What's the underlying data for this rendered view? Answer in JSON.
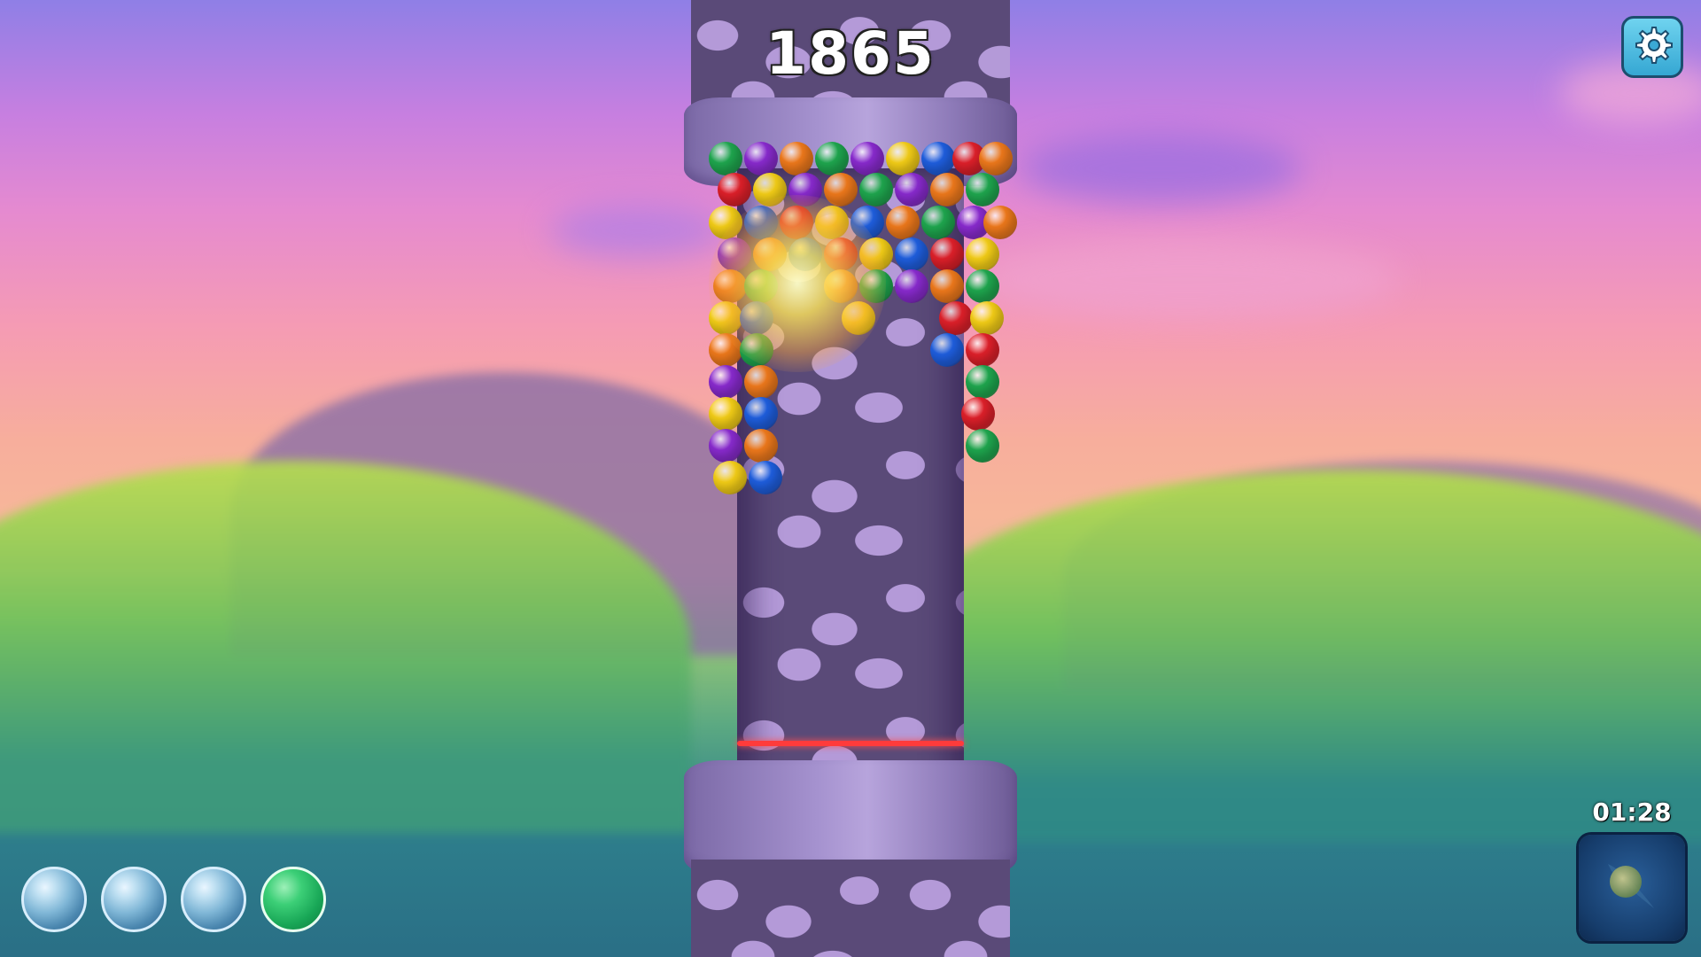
{
  "hud": {
    "score": "1865",
    "timer": "01:28",
    "settings_icon": "gear-icon",
    "powerup_icon": "comet-powerup-icon"
  },
  "ball_queue": [
    {
      "state": "empty",
      "icon": "empty-bubble-icon"
    },
    {
      "state": "empty",
      "icon": "empty-bubble-icon"
    },
    {
      "state": "empty",
      "icon": "empty-bubble-icon"
    },
    {
      "state": "loaded",
      "color": "#1fb85c",
      "icon": "green-ball-icon"
    }
  ],
  "colors": {
    "ball_red": "#e0202a",
    "ball_orange": "#f07a1c",
    "ball_yellow": "#f5cf17",
    "ball_green": "#1fa84f",
    "ball_blue": "#1f5fe0",
    "ball_purple": "#8a2bd0",
    "limit_line": "#ff3b3b",
    "tower_stone": "#b49ad8",
    "settings_button": "#4fc0e8"
  }
}
